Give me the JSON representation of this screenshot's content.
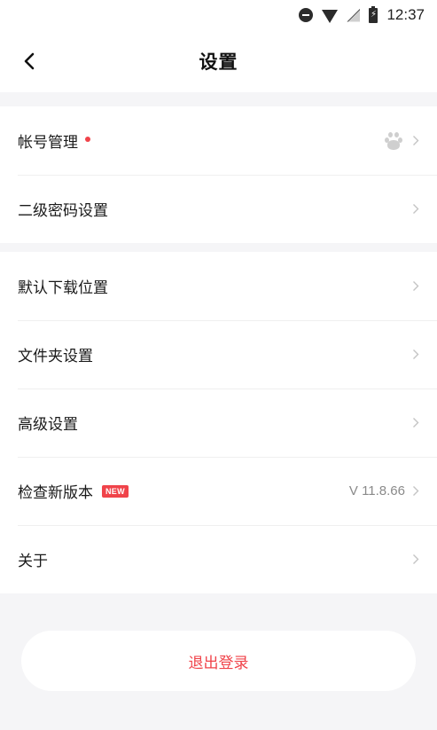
{
  "status_bar": {
    "time": "12:37",
    "icons": [
      "do-not-disturb-icon",
      "wifi-icon",
      "no-sim-icon",
      "battery-charging-icon"
    ]
  },
  "header": {
    "title": "设置",
    "back_icon": "chevron-left-icon"
  },
  "settings": {
    "group1": [
      {
        "label": "帐号管理",
        "has_red_dot": true,
        "trailing_icon": "baidu-paw-icon"
      },
      {
        "label": "二级密码设置"
      }
    ],
    "group2": [
      {
        "label": "默认下载位置"
      },
      {
        "label": "文件夹设置"
      },
      {
        "label": "高级设置"
      },
      {
        "label": "检查新版本",
        "badge": "NEW",
        "value": "V 11.8.66"
      },
      {
        "label": "关于"
      }
    ]
  },
  "logout": {
    "label": "退出登录"
  },
  "colors": {
    "accent": "#f0434a",
    "background": "#f5f5f7",
    "card": "#ffffff",
    "secondary_text": "#8a8a8a"
  }
}
